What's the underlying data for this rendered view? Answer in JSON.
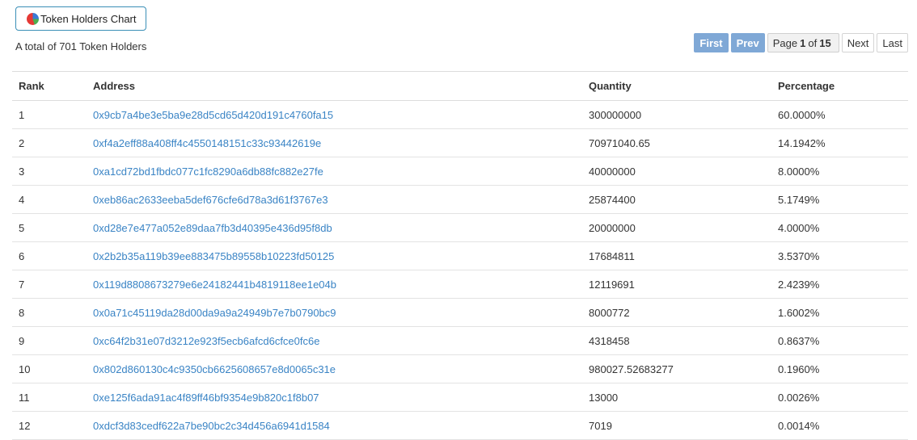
{
  "chart_button": {
    "label": "Token Holders Chart",
    "icon": "pie-chart-icon"
  },
  "summary": {
    "total_text": "A total of 701 Token Holders"
  },
  "pagination": {
    "first": "First",
    "prev": "Prev",
    "page_prefix": "Page",
    "current_page": "1",
    "of_label": "of",
    "total_pages": "15",
    "next": "Next",
    "last": "Last"
  },
  "table": {
    "headers": {
      "rank": "Rank",
      "address": "Address",
      "quantity": "Quantity",
      "percentage": "Percentage"
    },
    "rows": [
      {
        "rank": "1",
        "address": "0x9cb7a4be3e5ba9e28d5cd65d420d191c4760fa15",
        "quantity": "300000000",
        "percentage": "60.0000%"
      },
      {
        "rank": "2",
        "address": "0xf4a2eff88a408ff4c4550148151c33c93442619e",
        "quantity": "70971040.65",
        "percentage": "14.1942%"
      },
      {
        "rank": "3",
        "address": "0xa1cd72bd1fbdc077c1fc8290a6db88fc882e27fe",
        "quantity": "40000000",
        "percentage": "8.0000%"
      },
      {
        "rank": "4",
        "address": "0xeb86ac2633eeba5def676cfe6d78a3d61f3767e3",
        "quantity": "25874400",
        "percentage": "5.1749%"
      },
      {
        "rank": "5",
        "address": "0xd28e7e477a052e89daa7fb3d40395e436d95f8db",
        "quantity": "20000000",
        "percentage": "4.0000%"
      },
      {
        "rank": "6",
        "address": "0x2b2b35a119b39ee883475b89558b10223fd50125",
        "quantity": "17684811",
        "percentage": "3.5370%"
      },
      {
        "rank": "7",
        "address": "0x119d8808673279e6e24182441b4819118ee1e04b",
        "quantity": "12119691",
        "percentage": "2.4239%"
      },
      {
        "rank": "8",
        "address": "0x0a71c45119da28d00da9a9a24949b7e7b0790bc9",
        "quantity": "8000772",
        "percentage": "1.6002%"
      },
      {
        "rank": "9",
        "address": "0xc64f2b31e07d3212e923f5ecb6afcd6cfce0fc6e",
        "quantity": "4318458",
        "percentage": "0.8637%"
      },
      {
        "rank": "10",
        "address": "0x802d860130c4c9350cb6625608657e8d0065c31e",
        "quantity": "980027.52683277",
        "percentage": "0.1960%"
      },
      {
        "rank": "11",
        "address": "0xe125f6ada91ac4f89ff46bf9354e9b820c1f8b07",
        "quantity": "13000",
        "percentage": "0.0026%"
      },
      {
        "rank": "12",
        "address": "0xdcf3d83cedf622a7be90bc2c34d456a6941d1584",
        "quantity": "7019",
        "percentage": "0.0014%"
      }
    ]
  },
  "colors": {
    "link": "#3a84c5",
    "pager_disabled": "#7fa8d6",
    "button_border": "#3a8fb7"
  }
}
